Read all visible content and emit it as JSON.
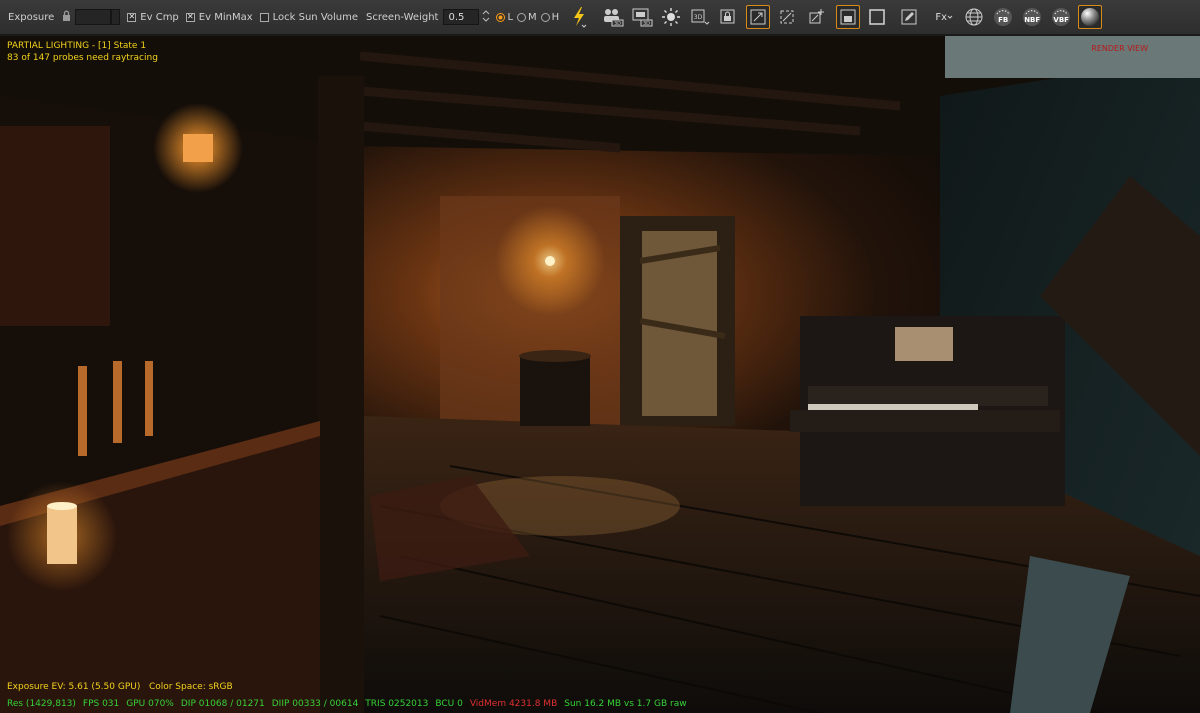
{
  "toolbar": {
    "exposure_label": "Exposure",
    "ev_cmp_label": "Ev Cmp",
    "ev_minmax_label": "Ev MinMax",
    "lock_sun_volume_label": "Lock Sun Volume",
    "screen_weight_label": "Screen-Weight",
    "screen_weight_value": "0.5",
    "quality_low": "L",
    "quality_medium": "M",
    "quality_high": "H",
    "ev_cmp_checked": "✕",
    "ev_minmax_checked": "✕",
    "fx_label": "Fx",
    "fb_label": "FB",
    "nbf_label": "NBF",
    "vbf_label": "VBF",
    "badge_3d": "3D",
    "accent_color": "#ff9c1a"
  },
  "hud": {
    "title": "PARTIAL LIGHTING - [1] State 1",
    "probes": "83 of 147 probes need raytracing",
    "render_view": "RENDER VIEW",
    "exposure_ev": "Exposure EV: 5.61 (5.50 GPU)",
    "color_space": "Color Space: sRGB",
    "res": "Res (1429,813)",
    "fps": "FPS 031",
    "gpu": "GPU 070%",
    "dip": "DIP 01068 / 01271",
    "diip": "DIIP 00333 / 00614",
    "tris": "TRIS 0252013",
    "bcu": "BCU 0",
    "vidmem": "VidMem 4231.8 MB",
    "sun": "Sun 16.2 MB vs 1.7 GB raw"
  },
  "colors": {
    "hud_yellow": "#f2d21c",
    "hud_green": "#35d235",
    "hud_red": "#e03030"
  }
}
